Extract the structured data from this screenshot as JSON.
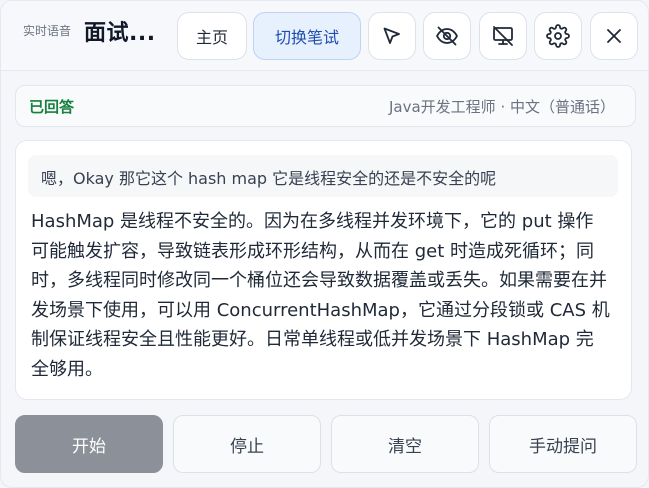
{
  "header": {
    "subtitle": "实时语音",
    "title": "面试...",
    "home_label": "主页",
    "switch_label": "切换笔试",
    "icons": [
      "cursor-icon",
      "eye-off-icon",
      "monitor-off-icon",
      "gear-icon",
      "close-icon"
    ]
  },
  "status": {
    "label": "已回答",
    "meta": "Java开发工程师 · 中文（普通话）",
    "accent_color": "#16803c"
  },
  "conversation": {
    "question": "嗯，Okay 那它这个 hash map 它是线程安全的还是不安全的呢",
    "answer": "HashMap 是线程不安全的。因为在多线程并发环境下，它的 put 操作可能触发扩容，导致链表形成环形结构，从而在 get 时造成死循环；同时，多线程同时修改同一个桶位还会导致数据覆盖或丢失。如果需要在并发场景下使用，可以用 ConcurrentHashMap，它通过分段锁或 CAS 机制保证线程安全且性能更好。日常单线程或低并发场景下 HashMap 完全够用。"
  },
  "controls": {
    "start_label": "开始",
    "stop_label": "停止",
    "clear_label": "清空",
    "manual_label": "手动提问"
  }
}
